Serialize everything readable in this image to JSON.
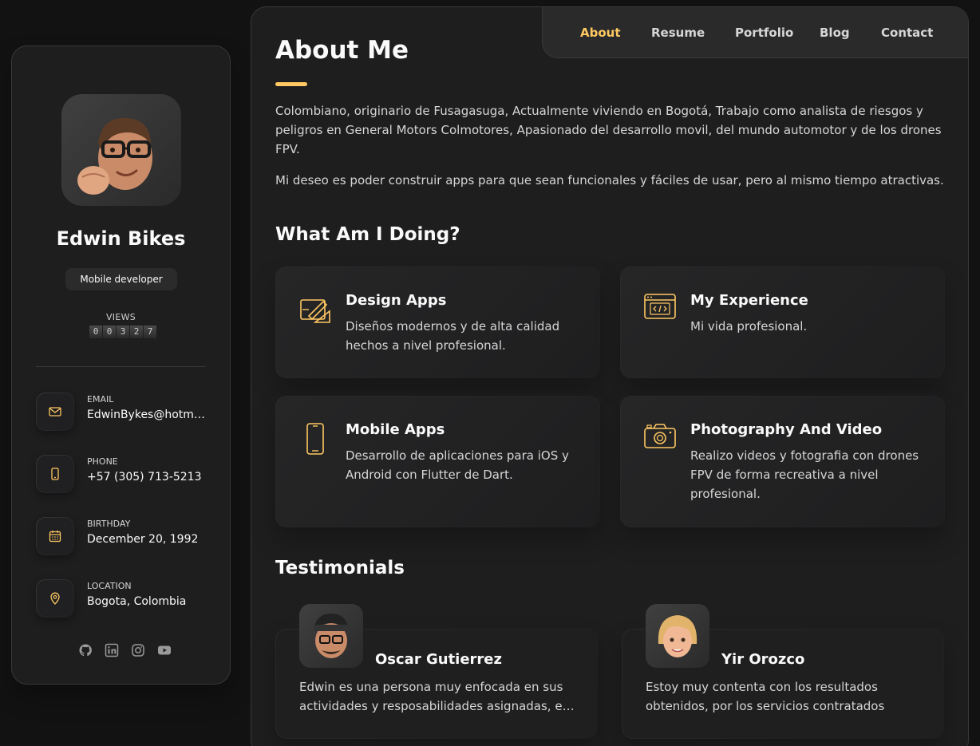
{
  "profile": {
    "name": "Edwin Bikes",
    "title": "Mobile developer",
    "views_label": "VIEWS",
    "views_digits": [
      "0",
      "0",
      "3",
      "2",
      "7"
    ]
  },
  "contacts": [
    {
      "title": "EMAIL",
      "value": "EdwinBykes@hotma…",
      "icon": "mail-icon"
    },
    {
      "title": "PHONE",
      "value": "+57 (305) 713-5213",
      "icon": "phone-icon"
    },
    {
      "title": "BIRTHDAY",
      "value": "December 20, 1992",
      "icon": "calendar-icon"
    },
    {
      "title": "LOCATION",
      "value": "Bogota, Colombia",
      "icon": "location-icon"
    }
  ],
  "socials": [
    "github-icon",
    "linkedin-icon",
    "instagram-icon",
    "youtube-icon"
  ],
  "nav": {
    "items": [
      "About",
      "Resume",
      "Portfolio",
      "Blog",
      "Contact"
    ],
    "active": "About"
  },
  "about": {
    "title": "About Me",
    "paragraphs": [
      "Colombiano, originario de Fusagasuga, Actualmente viviendo en Bogotá, Trabajo como analista de riesgos y peligros en General Motors Colmotores, Apasionado del desarrollo movil, del mundo automotor y de los drones FPV.",
      "Mi deseo es poder construir apps para que sean funcionales y fáciles de usar, pero al mismo tiempo atractivas."
    ]
  },
  "services": {
    "title": "What Am I Doing?",
    "items": [
      {
        "title": "Design Apps",
        "text": "Diseños modernos y de alta calidad hechos a nivel profesional.",
        "icon": "design-icon"
      },
      {
        "title": "My Experience",
        "text": "Mi vida profesional.",
        "icon": "code-window-icon"
      },
      {
        "title": "Mobile Apps",
        "text": "Desarrollo de aplicaciones para iOS y Android con Flutter de Dart.",
        "icon": "smartphone-icon"
      },
      {
        "title": "Photography And Video",
        "text": "Realizo videos y fotografia con drones FPV de forma recreativa a nivel profesional.",
        "icon": "camera-icon"
      }
    ]
  },
  "testimonials": {
    "title": "Testimonials",
    "items": [
      {
        "name": "Oscar Gutierrez",
        "text": "Edwin es una persona muy enfocada en sus actividades y resposabilidades asignadas, e…"
      },
      {
        "name": "Yir Orozco",
        "text": "Estoy muy contenta con los resultados obtenidos, por los servicios contratados para…"
      }
    ]
  },
  "colors": {
    "accent": "#ffc862",
    "background": "#121212",
    "card": "#1e1e1f",
    "border": "#383838"
  }
}
